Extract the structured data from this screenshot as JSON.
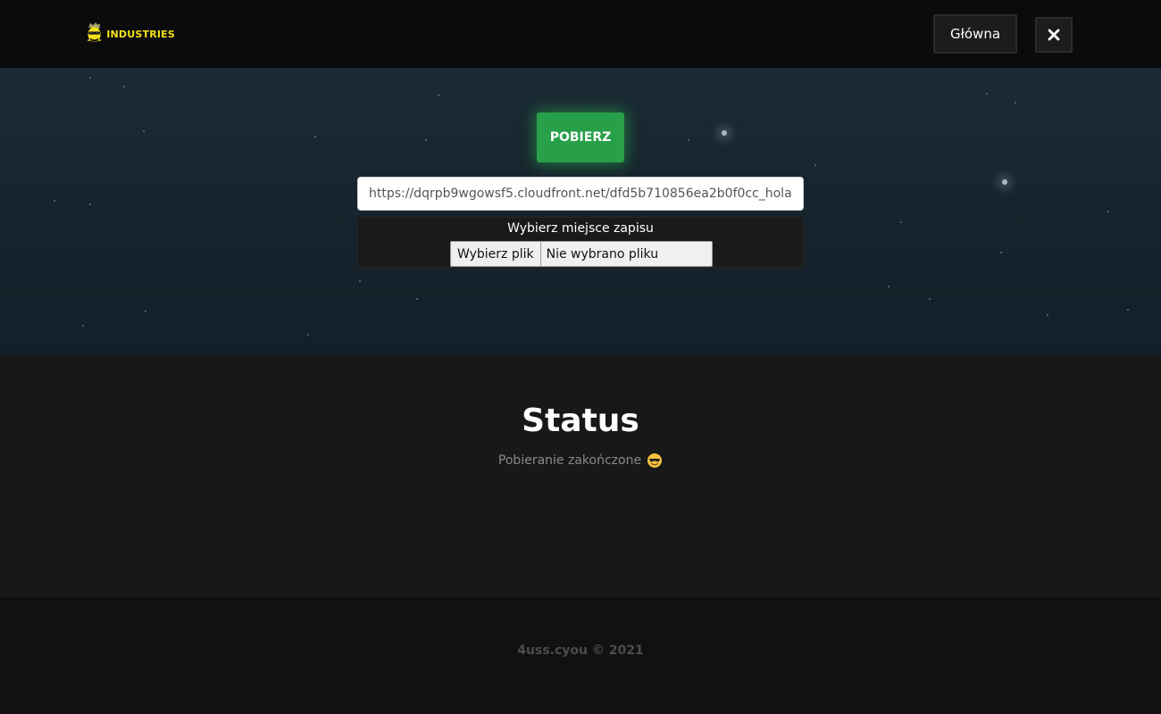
{
  "header": {
    "logo_text": "INDUSTRIES",
    "home_label": "Główna",
    "close_icon": "close-icon"
  },
  "hero": {
    "download_label": "POBIERZ",
    "url_value": "https://dqrpb9wgowsf5.cloudfront.net/dfd5b710856ea2b0f0cc_hola",
    "save_label": "Wybierz miejsce zapisu",
    "file_button_label": "Wybierz plik",
    "file_status": "Nie wybrano pliku"
  },
  "status": {
    "title": "Status",
    "text": "Pobieranie zakończone",
    "emoji_icon": "sunglasses-emoji-icon"
  },
  "footer": {
    "text": "4uss.cyou © 2021"
  },
  "colors": {
    "accent_green": "#28a04a",
    "logo_yellow": "#f3e21a",
    "hero_bg": "#1b2b35"
  }
}
